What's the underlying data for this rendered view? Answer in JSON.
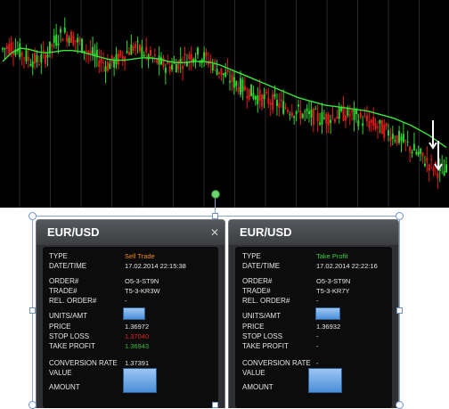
{
  "panels": [
    {
      "title": "EUR/USD",
      "close_icon": "close-icon",
      "fields": {
        "type_label": "TYPE",
        "type_value": "Sell Trade",
        "datetime_label": "DATE/TIME",
        "datetime_value": "17.02.2014 22:15:38",
        "order_label": "ORDER#",
        "order_value": "O5-3-ST9N",
        "trade_label": "TRADE#",
        "trade_value": "T5-3-KR3W",
        "rel_label": "REL. ORDER#",
        "rel_value": "-",
        "units_label": "UNITS/AMT",
        "price_label": "PRICE",
        "price_value": "1.36972",
        "sl_label": "STOP LOSS",
        "sl_value": "1.37040",
        "tp_label": "TAKE PROFIT",
        "tp_value": "1.36943",
        "conv_label": "CONVERSION RATE",
        "conv_value": "1.37391",
        "value_label": "VALUE",
        "amount_label": "AMOUNT"
      }
    },
    {
      "title": "EUR/USD",
      "fields": {
        "type_label": "TYPE",
        "type_value": "Take Profit",
        "datetime_label": "DATE/TIME",
        "datetime_value": "17.02.2014 22:22:16",
        "order_label": "ORDER#",
        "order_value": "O5-3-ST9N",
        "trade_label": "TRADE#",
        "trade_value": "T5-3-KR7Y",
        "rel_label": "REL. ORDER#",
        "rel_value": "-",
        "units_label": "UNITS/AMT",
        "price_label": "PRICE",
        "price_value": "1.36932",
        "sl_label": "STOP LOSS",
        "sl_value": "-",
        "tp_label": "TAKE PROFIT",
        "tp_value": "-",
        "conv_label": "CONVERSION RATE",
        "conv_value": "-",
        "value_label": "VALUE",
        "amount_label": "AMOUNT"
      }
    }
  ],
  "colors": {
    "chart_bg": "#000000",
    "up_candle": "#2fd52f",
    "down_candle": "#e01b1b",
    "moving_average": "#39e639",
    "type_sell": "#f0861a",
    "type_take_profit": "#3fd23f",
    "stop_loss": "#e0241e",
    "take_profit": "#2fbf2f",
    "arrow": "#ffffff"
  },
  "chart_data": {
    "type": "candlestick",
    "series": [
      {
        "values": [
          1.3798,
          1.3801,
          1.3796,
          1.379,
          1.3788,
          1.3793,
          1.3805,
          1.3812,
          1.3808,
          1.3802,
          1.3795,
          1.379,
          1.3785,
          1.3788,
          1.3794,
          1.38,
          1.3797,
          1.3791,
          1.3787,
          1.3784,
          1.3786,
          1.379,
          1.3794,
          1.3792,
          1.3787,
          1.378,
          1.3774,
          1.3769,
          1.3765,
          1.376,
          1.3757,
          1.3755,
          1.3752,
          1.3749,
          1.3746,
          1.3744,
          1.3742,
          1.3741,
          1.3743,
          1.3745,
          1.3744,
          1.3741,
          1.3738,
          1.3735,
          1.3731,
          1.3727,
          1.3722,
          1.3716,
          1.371,
          1.3704,
          1.3698,
          1.3697
        ]
      },
      {
        "values": [
          1.3788,
          1.3795,
          1.3799,
          1.3798,
          1.3796,
          1.3795,
          1.3796,
          1.3797,
          1.3797,
          1.3796,
          1.3794,
          1.3792,
          1.379,
          1.3789,
          1.3789,
          1.379,
          1.3791,
          1.3791,
          1.379,
          1.3788,
          1.3787,
          1.3787,
          1.3788,
          1.3788,
          1.3787,
          1.3785,
          1.3782,
          1.3779,
          1.3776,
          1.3773,
          1.377,
          1.3767,
          1.3764,
          1.3761,
          1.3758,
          1.3756,
          1.3754,
          1.3752,
          1.3751,
          1.375,
          1.3749,
          1.3748,
          1.3747,
          1.3745,
          1.3743,
          1.3741,
          1.3738,
          1.3735,
          1.3731,
          1.3727,
          1.3722,
          1.3717
        ]
      }
    ]
  }
}
